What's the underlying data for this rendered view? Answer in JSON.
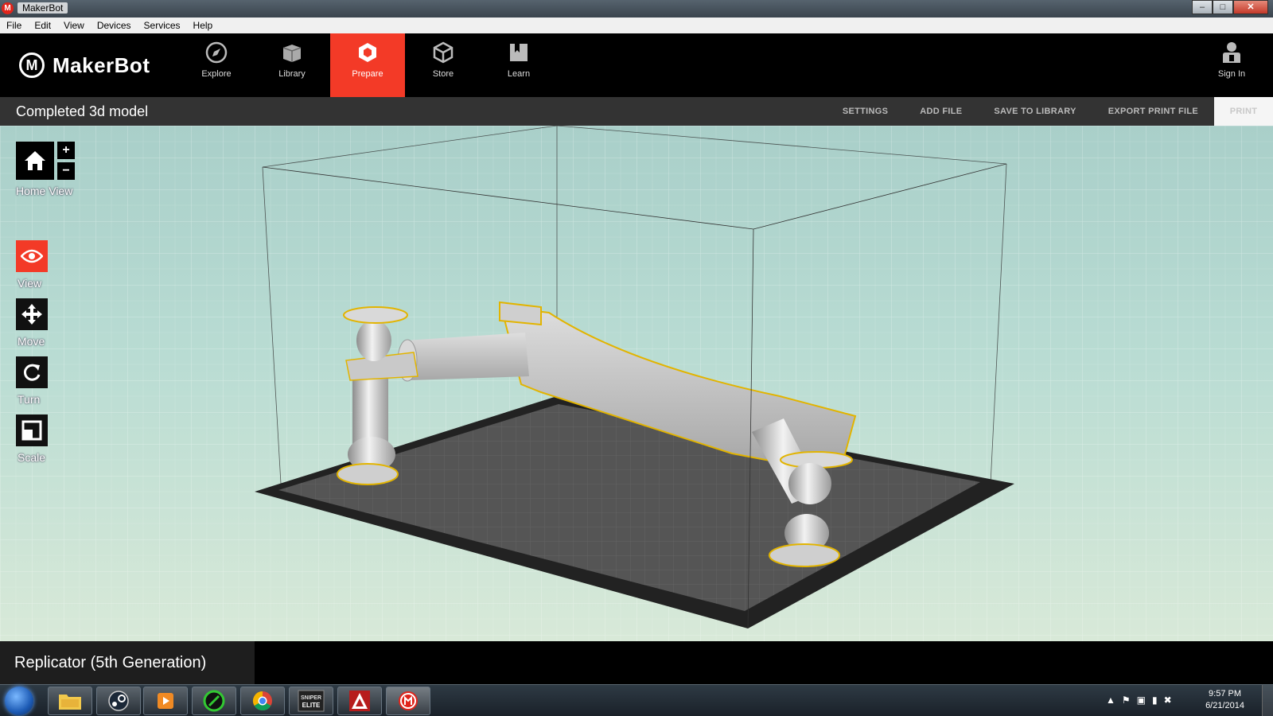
{
  "window": {
    "title": "MakerBot",
    "min": "–",
    "max": "□",
    "close": "✕"
  },
  "menu": [
    "File",
    "Edit",
    "View",
    "Devices",
    "Services",
    "Help"
  ],
  "brand": {
    "mark": "M",
    "name": "MakerBot"
  },
  "nav": {
    "items": [
      {
        "label": "Explore",
        "icon": "compass-icon"
      },
      {
        "label": "Library",
        "icon": "library-icon"
      },
      {
        "label": "Prepare",
        "icon": "prepare-icon",
        "active": true
      },
      {
        "label": "Store",
        "icon": "cube-icon"
      },
      {
        "label": "Learn",
        "icon": "book-icon"
      }
    ],
    "signin": "Sign In",
    "accent": "#f33a27"
  },
  "subbar": {
    "title": "Completed 3d model",
    "actions": {
      "settings": "SETTINGS",
      "add_file": "ADD FILE",
      "save": "SAVE TO LIBRARY",
      "export": "EXPORT PRINT FILE",
      "print": "PRINT"
    }
  },
  "tools": {
    "home": "Home View",
    "zoom_in": "+",
    "zoom_out": "−",
    "view": "View",
    "move": "Move",
    "turn": "Turn",
    "scale": "Scale"
  },
  "printer": {
    "name": "Replicator (5th Generation)"
  },
  "taskbar": {
    "apps": [
      "explorer",
      "steam",
      "media-player",
      "app-green",
      "chrome",
      "sniper-elite",
      "autodesk",
      "makerbot"
    ],
    "sniper_label": "SNIPER ELITE",
    "time": "9:57 PM",
    "date": "6/21/2014"
  }
}
